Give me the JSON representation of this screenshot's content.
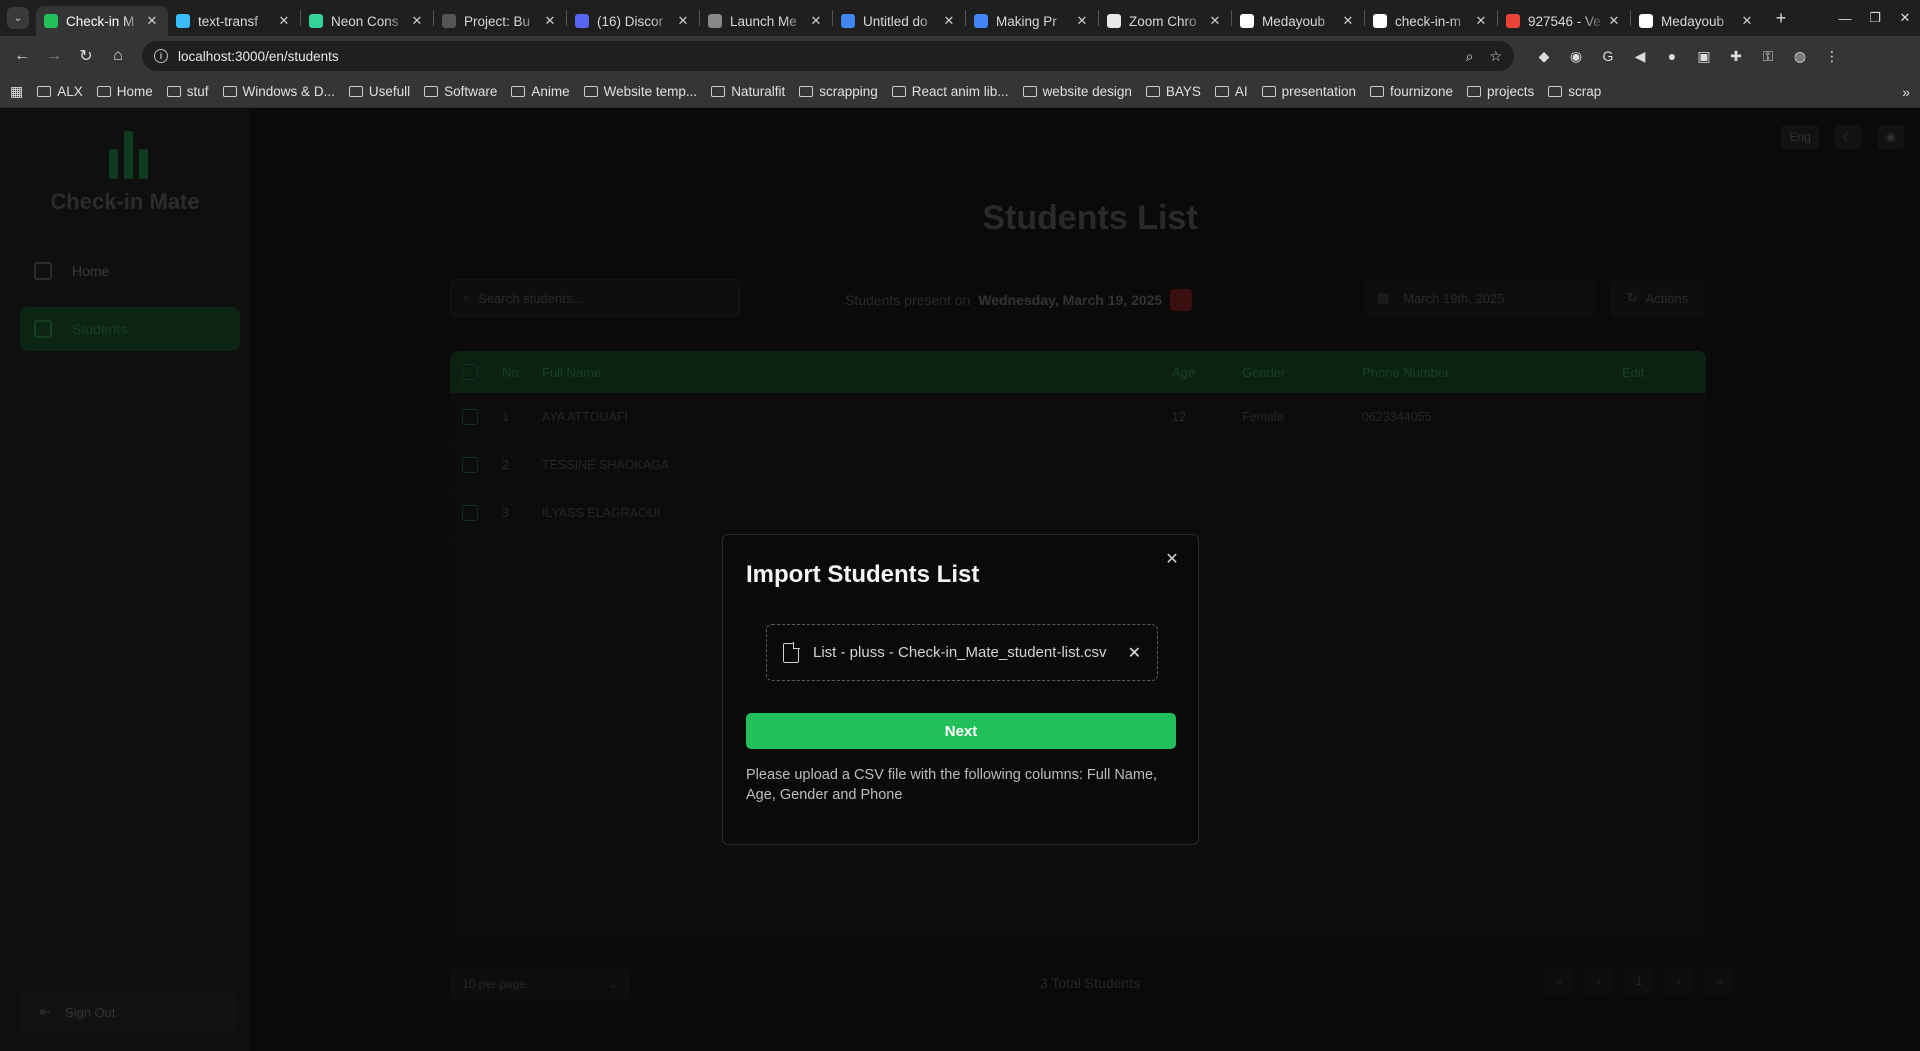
{
  "browser": {
    "tabs": [
      {
        "title": "Check-in M",
        "favicon_color": "#22c05a",
        "active": true
      },
      {
        "title": "text-transf",
        "favicon_color": "#38bdf8"
      },
      {
        "title": "Neon Cons",
        "favicon_color": "#34d399"
      },
      {
        "title": "Project: Bu",
        "favicon_color": "#555555"
      },
      {
        "title": "(16) Discor",
        "favicon_color": "#5865f2"
      },
      {
        "title": "Launch Me",
        "favicon_color": "#888888"
      },
      {
        "title": "Untitled do",
        "favicon_color": "#4285f4"
      },
      {
        "title": "Making Pr",
        "favicon_color": "#4285f4"
      },
      {
        "title": "Zoom Chro",
        "favicon_color": "#e8e8e8"
      },
      {
        "title": "Medayoub",
        "favicon_color": "#ffffff"
      },
      {
        "title": "check-in-m",
        "favicon_color": "#ffffff"
      },
      {
        "title": "927546 - Ve",
        "favicon_color": "#ea4335"
      },
      {
        "title": "Medayoub",
        "favicon_color": "#ffffff"
      }
    ],
    "url": "localhost:3000/en/students",
    "bookmarks": [
      "ALX",
      "Home",
      "stuf",
      "Windows & D...",
      "Usefull",
      "Software",
      "Anime",
      "Website temp...",
      "Naturalfit",
      "scrapping",
      "React anim lib...",
      "website design",
      "BAYS",
      "AI",
      "presentation",
      "fournizone",
      "projects",
      "scrap"
    ]
  },
  "app": {
    "brand": "Check-in Mate",
    "nav": [
      {
        "label": "Home",
        "active": false
      },
      {
        "label": "Students",
        "active": true
      }
    ],
    "signout": "Sign Out",
    "top_controls": [
      "Eng",
      "",
      ""
    ],
    "page_title": "Students List",
    "search_placeholder": "Search students...",
    "present_label": "Students present on",
    "present_date": "Wednesday, March 19, 2025",
    "date_picker": "March 19th, 2025",
    "actions_label": "Actions",
    "table": {
      "headers": [
        "",
        "No.",
        "Full Name",
        "Age",
        "Gender",
        "Phone Number",
        "Edit"
      ],
      "rows": [
        [
          "",
          "1",
          "AYA ATTOUAFI",
          "12",
          "Female",
          "0623344055",
          ""
        ],
        [
          "",
          "2",
          "TESSINE SHAOKAGA",
          "",
          "",
          "",
          ""
        ],
        [
          "",
          "3",
          "ILYASS ELAGRAOUI",
          "",
          "",
          "",
          ""
        ]
      ]
    },
    "per_page": "10 per page",
    "total": "3 Total Students",
    "pager": [
      "«",
      "‹",
      "1",
      "›",
      "»"
    ]
  },
  "modal": {
    "title": "Import Students List",
    "file_name": "List - pluss - Check-in_Mate_student-list.csv",
    "next_label": "Next",
    "hint": "Please upload a CSV file with the following columns: Full Name, Age, Gender and Phone",
    "accent": "#22c05a"
  }
}
